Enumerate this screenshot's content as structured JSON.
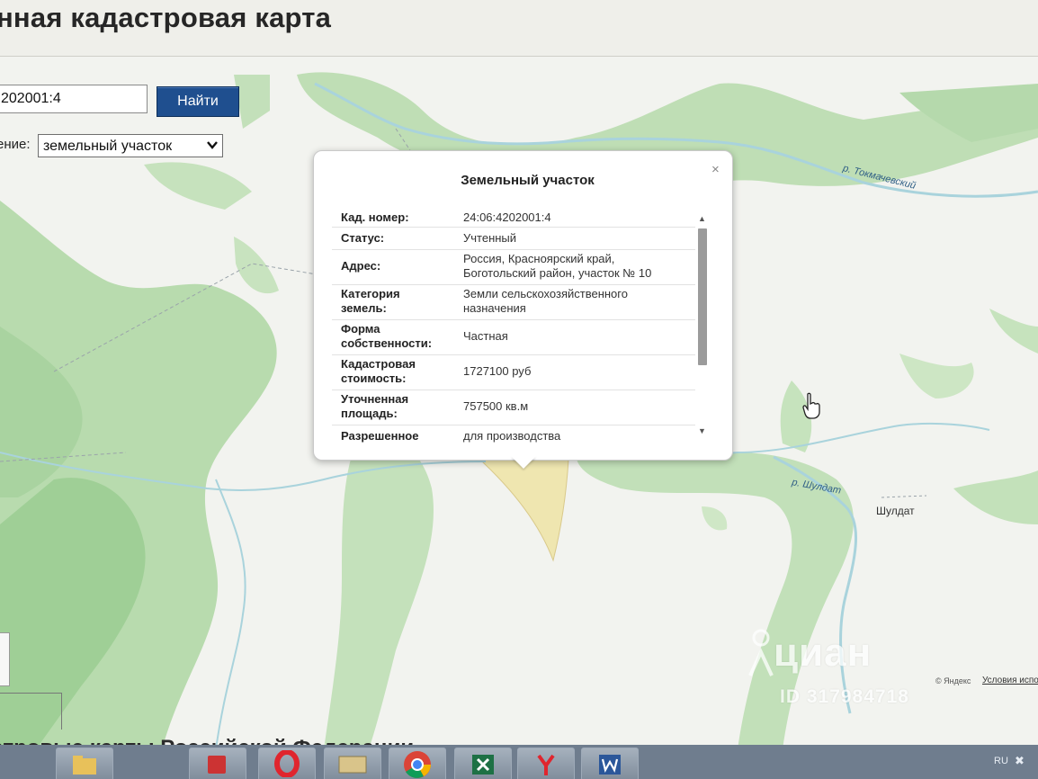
{
  "header": {
    "title": "нная кадастровая карта"
  },
  "search": {
    "value": "202001:4",
    "button_label": "Найти",
    "type_label": "ение:",
    "type_value": "земельный участок"
  },
  "map": {
    "river_labels": [
      "р. Токмачевский",
      "р. Шулдат"
    ],
    "town": "Шулдат",
    "yandex": "© Яндекс",
    "terms": "Условия испо"
  },
  "popup": {
    "title": "Земельный участок",
    "close": "×",
    "rows": [
      {
        "label": [
          "Кад. номер:"
        ],
        "value": [
          "24:06:4202001:4"
        ]
      },
      {
        "label": [
          "Статус:"
        ],
        "value": [
          "Учтенный"
        ]
      },
      {
        "label": [
          "Адрес:"
        ],
        "value": [
          "Россия, Красноярский край,",
          "Боготольский район, участок № 10"
        ]
      },
      {
        "label": [
          "Категория",
          "земель:"
        ],
        "value": [
          "Земли сельскохозяйственного",
          "назначения"
        ]
      },
      {
        "label": [
          "Форма",
          "собственности:"
        ],
        "value": [
          "Частная"
        ]
      },
      {
        "label": [
          "Кадастровая",
          "стоимость:"
        ],
        "value": [
          "1727100 руб"
        ]
      },
      {
        "label": [
          "Уточненная",
          "площадь:"
        ],
        "value": [
          "757500 кв.м"
        ]
      },
      {
        "label": [
          "Разрешенное"
        ],
        "value": [
          "для производства"
        ]
      }
    ]
  },
  "watermark": {
    "brand": "циан",
    "id": "ID 317984718"
  },
  "footer": {
    "text": "стровые карты Российской Федерации"
  },
  "taskbar": {
    "lang": "RU"
  },
  "colors": {
    "map_green": "#b9dcb0",
    "river": "#a9d3dc",
    "button_blue": "#1f4f8f",
    "plot_yellow": "#efe6b0"
  }
}
